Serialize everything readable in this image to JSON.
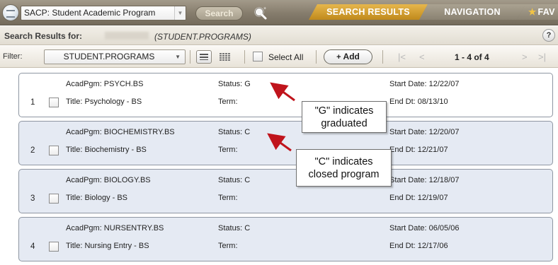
{
  "topbar": {
    "app_title": "SACP: Student Academic Program",
    "search_label": "Search",
    "tabs": {
      "search_results": "SEARCH RESULTS",
      "navigation": "NAVIGATION",
      "favorites": "FAV"
    }
  },
  "results_header": {
    "label": "Search Results for:",
    "query": "(STUDENT.PROGRAMS)",
    "help": "?"
  },
  "toolbar": {
    "filter_label": "Filter:",
    "filter_value": "STUDENT.PROGRAMS",
    "select_all_label": "Select All",
    "add_label": "Add",
    "pager": {
      "first": "|<",
      "prev": "<",
      "count": "1 - 4 of 4",
      "next": ">",
      "last": ">|"
    }
  },
  "records": [
    {
      "number": "1",
      "acadpgm": "AcadPgm: PSYCH.BS",
      "title": "Title: Psychology - BS",
      "status": "Status: G",
      "term": "Term:",
      "start_date": "Start Date: 12/22/07",
      "end_date": "End Dt: 08/13/10"
    },
    {
      "number": "2",
      "acadpgm": "AcadPgm: BIOCHEMISTRY.BS",
      "title": "Title: Biochemistry - BS",
      "status": "Status: C",
      "term": "Term:",
      "start_date": "Start Date: 12/20/07",
      "end_date": "End Dt: 12/21/07"
    },
    {
      "number": "3",
      "acadpgm": "AcadPgm: BIOLOGY.BS",
      "title": "Title: Biology - BS",
      "status": "Status: C",
      "term": "Term:",
      "start_date": "Start Date: 12/18/07",
      "end_date": "End Dt: 12/19/07"
    },
    {
      "number": "4",
      "acadpgm": "AcadPgm: NURSENTRY.BS",
      "title": "Title: Nursing Entry - BS",
      "status": "Status: C",
      "term": "Term:",
      "start_date": "Start Date: 06/05/06",
      "end_date": "End Dt: 12/17/06"
    }
  ],
  "annotations": {
    "graduated": {
      "line1": "\"G\" indicates",
      "line2": "graduated"
    },
    "closed": {
      "line1": "\"C\" indicates",
      "line2": "closed program"
    }
  },
  "colors": {
    "topbar": "#857c6c",
    "active_tab": "#d9a234",
    "alt_row": "#e5eaf3",
    "arrow": "#c0141c"
  },
  "icons": {
    "home": "home-icon",
    "magnifier": "magnifier-plus-icon",
    "list_view": "list-view-icon",
    "grid_view": "grid-view-icon",
    "star": "star-icon"
  }
}
